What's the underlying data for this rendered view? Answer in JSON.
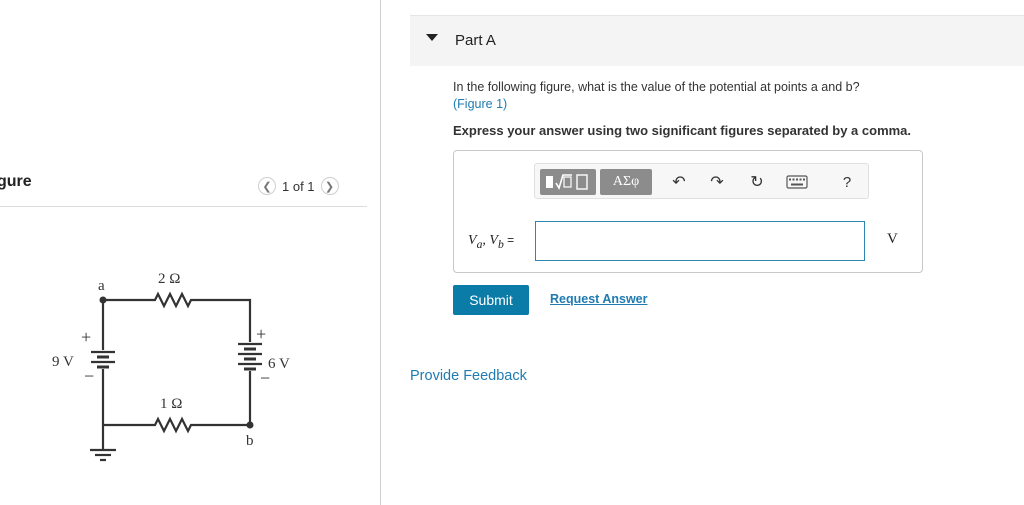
{
  "figure": {
    "title": "gure",
    "pager_text": "1 of 1",
    "prev_icon": "chevron-left-icon",
    "next_icon": "chevron-right-icon",
    "circuit": {
      "node_a": "a",
      "node_b": "b",
      "resistor_top": "2 Ω",
      "resistor_bottom": "1 Ω",
      "battery_left": "9 V",
      "battery_right": "6 V",
      "plus": "+",
      "minus": "−"
    }
  },
  "part": {
    "title": "Part A",
    "question": "In the following figure, what is the value of the potential at points a and b?",
    "figure_link": "(Figure 1)",
    "instruction": "Express your answer using two significant figures separated by a comma."
  },
  "toolbar": {
    "template_icon": "fraction-sqrt-template-icon",
    "greek_label": "ΑΣφ",
    "undo_icon": "undo-icon",
    "redo_icon": "redo-icon",
    "reset_icon": "reset-icon",
    "keyboard_icon": "keyboard-icon",
    "help_label": "?"
  },
  "answer": {
    "label_va": "V",
    "sub_a": "a",
    "sep": ", ",
    "label_vb": "V",
    "sub_b": "b",
    "equals": " =",
    "value": "",
    "unit": "V"
  },
  "actions": {
    "submit": "Submit",
    "request_answer": "Request Answer",
    "feedback": "Provide Feedback"
  },
  "colors": {
    "accent": "#0b7ba8",
    "link": "#1f7bb0",
    "header_bg": "#f4f4f4"
  }
}
